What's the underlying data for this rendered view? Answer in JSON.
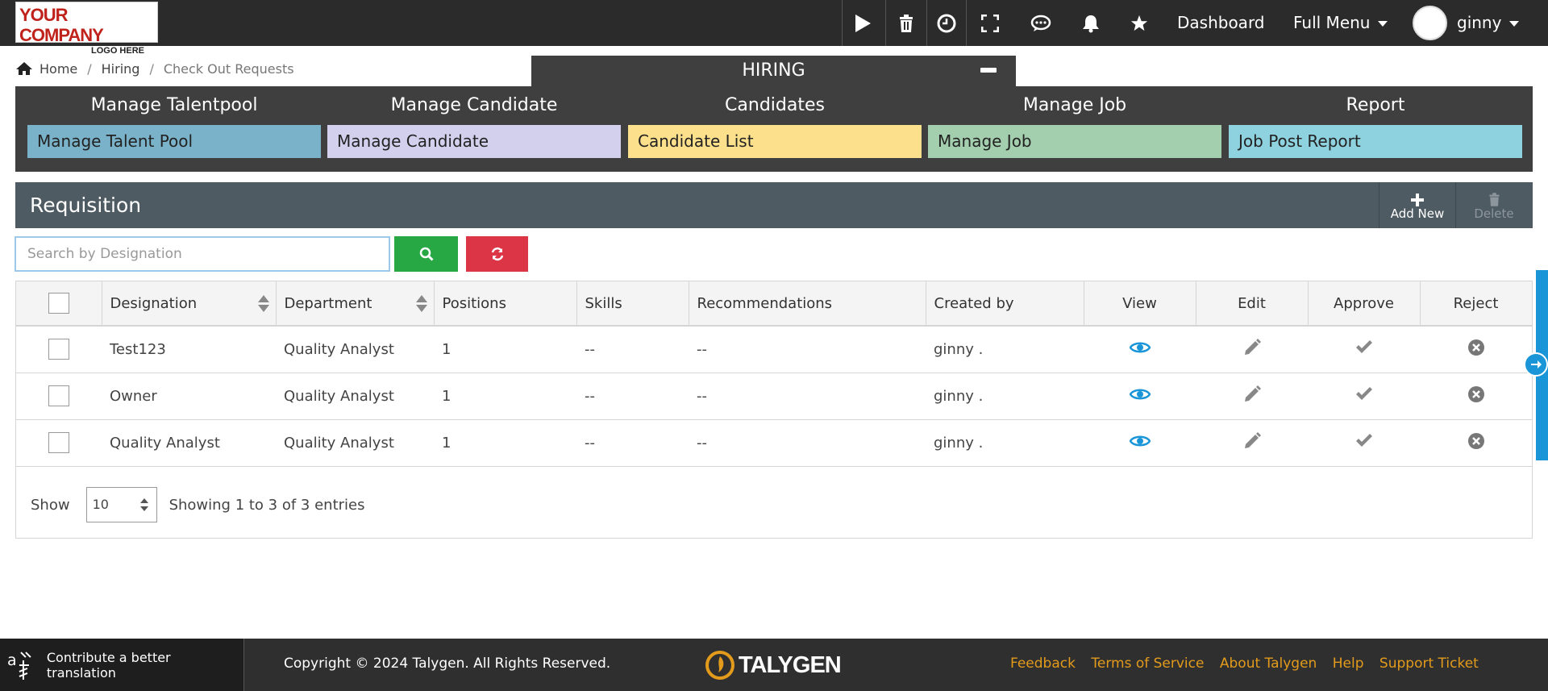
{
  "brand": {
    "logo_line1": "YOUR COMPANY",
    "logo_line2": "LOGO HERE"
  },
  "topbar": {
    "icons": [
      "play-icon",
      "trash-icon",
      "clock-icon",
      "fullscreen-icon",
      "chat-icon",
      "bell-icon",
      "star-icon"
    ],
    "dashboard_label": "Dashboard",
    "full_menu_label": "Full Menu",
    "user_name": "ginny"
  },
  "breadcrumb": {
    "home": "Home",
    "section": "Hiring",
    "current": "Check Out Requests",
    "separator": "/"
  },
  "hiring": {
    "title": "HIRING",
    "columns": [
      {
        "title": "Manage Talentpool",
        "tile": "Manage Talent Pool",
        "color": "#7ab3c9"
      },
      {
        "title": "Manage Candidate",
        "tile": "Manage Candidate",
        "color": "#d3d0ee"
      },
      {
        "title": "Candidates",
        "tile": "Candidate List",
        "color": "#fde08c"
      },
      {
        "title": "Manage Job",
        "tile": "Manage Job",
        "color": "#a3cfae"
      },
      {
        "title": "Report",
        "tile": "Job Post Report",
        "color": "#8ed1df"
      }
    ]
  },
  "requisition": {
    "title": "Requisition",
    "add_new": "Add New",
    "delete": "Delete"
  },
  "search": {
    "placeholder": "Search by Designation",
    "value": ""
  },
  "table": {
    "headers": [
      "Designation",
      "Department",
      "Positions",
      "Skills",
      "Recommendations",
      "Created by",
      "View",
      "Edit",
      "Approve",
      "Reject"
    ],
    "rows": [
      {
        "designation": "Test123",
        "department": "Quality Analyst",
        "positions": "1",
        "skills": "--",
        "recommendations": "--",
        "created_by": "ginny ."
      },
      {
        "designation": "Owner",
        "department": "Quality Analyst",
        "positions": "1",
        "skills": "--",
        "recommendations": "--",
        "created_by": "ginny ."
      },
      {
        "designation": "Quality Analyst",
        "department": "Quality Analyst",
        "positions": "1",
        "skills": "--",
        "recommendations": "--",
        "created_by": "ginny ."
      }
    ]
  },
  "pagination": {
    "show_label": "Show",
    "page_size": "10",
    "info": "Showing 1 to 3 of 3 entries"
  },
  "footer": {
    "translate_label": "Contribute a better translation",
    "copyright": "Copyright © 2024 Talygen. All Rights Reserved.",
    "brand_name": "TALYGEN",
    "links": [
      "Feedback",
      "Terms of Service",
      "About Talygen",
      "Help",
      "Support Ticket"
    ]
  },
  "colors": {
    "search_button": "#28a745",
    "reset_button": "#dc3545",
    "view_icon": "#1a96d8",
    "link": "#e39b1c",
    "side_tab": "#1a96d8"
  }
}
